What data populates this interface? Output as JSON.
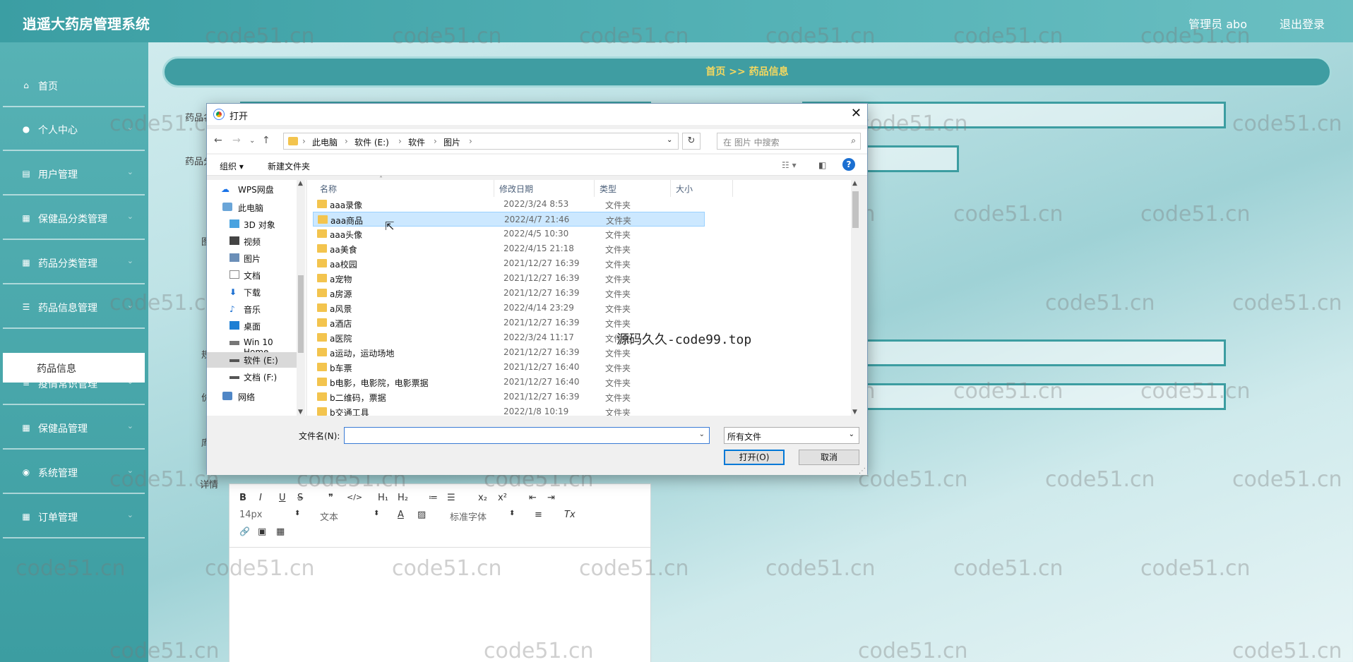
{
  "header": {
    "title": "逍遥大药房管理系统",
    "admin": "管理员 abo",
    "logout": "退出登录"
  },
  "sidebar": {
    "items": [
      {
        "label": "首页",
        "icon": "home-icon"
      },
      {
        "label": "个人中心",
        "icon": "user-icon"
      },
      {
        "label": "用户管理",
        "icon": "doc-icon"
      },
      {
        "label": "保健品分类管理",
        "icon": "grid-icon"
      },
      {
        "label": "药品分类管理",
        "icon": "grid-icon"
      },
      {
        "label": "药品信息管理",
        "icon": "sliders-icon"
      },
      {
        "label": "疫情常识管理",
        "icon": "list-icon"
      },
      {
        "label": "保健品管理",
        "icon": "grid-icon"
      },
      {
        "label": "系统管理",
        "icon": "pin-icon"
      },
      {
        "label": "订单管理",
        "icon": "grid-icon"
      }
    ],
    "active_sub": "药品信息"
  },
  "breadcrumb": "首页  >>  药品信息",
  "form": {
    "label_name": "药品名",
    "label_category": "药品分",
    "label_image": "图",
    "label_spec": "规",
    "label_price": "价",
    "label_stock": "库",
    "label_detail": "详情"
  },
  "editor": {
    "font_size": "14px",
    "text_style": "文本",
    "font_family": "标准字体",
    "buttons": [
      "B",
      "I",
      "U",
      "S",
      "❞",
      "</>",
      "H₁",
      "H₂",
      "≔",
      "☰",
      "x₂",
      "x²",
      "⇤",
      "⇥",
      "A",
      "▨",
      "≡",
      "Tx",
      "🔗",
      "▣",
      "▦"
    ]
  },
  "watermark": "code51.cn",
  "watermark_center": "源码久久-code99.top",
  "dialog": {
    "title": "打开",
    "path": [
      "此电脑",
      "软件 (E:)",
      "软件",
      "图片"
    ],
    "search_placeholder": "在 图片 中搜索",
    "organize": "组织 ▾",
    "new_folder": "新建文件夹",
    "tree": [
      {
        "label": "WPS网盘",
        "icon": "cloud-icon"
      },
      {
        "label": "此电脑",
        "icon": "computer-icon"
      },
      {
        "label": "3D 对象",
        "icon": "cube-icon"
      },
      {
        "label": "视频",
        "icon": "video-icon"
      },
      {
        "label": "图片",
        "icon": "picture-icon"
      },
      {
        "label": "文档",
        "icon": "document-icon"
      },
      {
        "label": "下载",
        "icon": "download-icon"
      },
      {
        "label": "音乐",
        "icon": "music-icon"
      },
      {
        "label": "桌面",
        "icon": "desktop-icon"
      },
      {
        "label": "Win 10 Home",
        "icon": "drive-icon"
      },
      {
        "label": "软件 (E:)",
        "icon": "drive-icon"
      },
      {
        "label": "文档 (F:)",
        "icon": "drive-icon"
      },
      {
        "label": "网络",
        "icon": "network-icon"
      }
    ],
    "columns": [
      "名称",
      "修改日期",
      "类型",
      "大小"
    ],
    "files": [
      {
        "name": "aaa录像",
        "date": "2022/3/24 8:53",
        "type": "文件夹"
      },
      {
        "name": "aaa商品",
        "date": "2022/4/7 21:46",
        "type": "文件夹"
      },
      {
        "name": "aaa头像",
        "date": "2022/4/5 10:30",
        "type": "文件夹"
      },
      {
        "name": "aa美食",
        "date": "2022/4/15 21:18",
        "type": "文件夹"
      },
      {
        "name": "aa校园",
        "date": "2021/12/27 16:39",
        "type": "文件夹"
      },
      {
        "name": "a宠物",
        "date": "2021/12/27 16:39",
        "type": "文件夹"
      },
      {
        "name": "a房源",
        "date": "2021/12/27 16:39",
        "type": "文件夹"
      },
      {
        "name": "a风景",
        "date": "2022/4/14 23:29",
        "type": "文件夹"
      },
      {
        "name": "a酒店",
        "date": "2021/12/27 16:39",
        "type": "文件夹"
      },
      {
        "name": "a医院",
        "date": "2022/3/24 11:17",
        "type": "文件夹"
      },
      {
        "name": "a运动，运动场地",
        "date": "2021/12/27 16:39",
        "type": "文件夹"
      },
      {
        "name": "b车票",
        "date": "2021/12/27 16:40",
        "type": "文件夹"
      },
      {
        "name": "b电影，电影院，电影票据",
        "date": "2021/12/27 16:40",
        "type": "文件夹"
      },
      {
        "name": "b二维码，票据",
        "date": "2021/12/27 16:39",
        "type": "文件夹"
      },
      {
        "name": "b交通工具",
        "date": "2022/1/8 10:19",
        "type": "文件夹"
      }
    ],
    "selected_file": "aaa商品",
    "filename_label": "文件名(N):",
    "filename_value": "",
    "filetype": "所有文件",
    "open": "打开(O)",
    "cancel": "取消"
  }
}
